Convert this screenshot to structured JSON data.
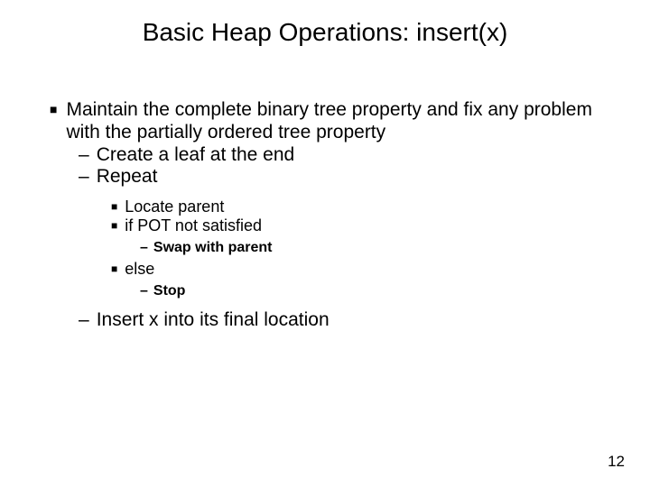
{
  "title": "Basic Heap Operations: insert(x)",
  "bullets": {
    "main": "Maintain the complete binary tree property and fix any problem with the partially ordered tree property",
    "create": "Create a leaf at the end",
    "repeat": "Repeat",
    "locate": "Locate parent",
    "ifpot": "if POT not satisfied",
    "swap": "Swap with parent",
    "else": "else",
    "stop": "Stop",
    "insert": "Insert x into its final location"
  },
  "page_number": "12"
}
